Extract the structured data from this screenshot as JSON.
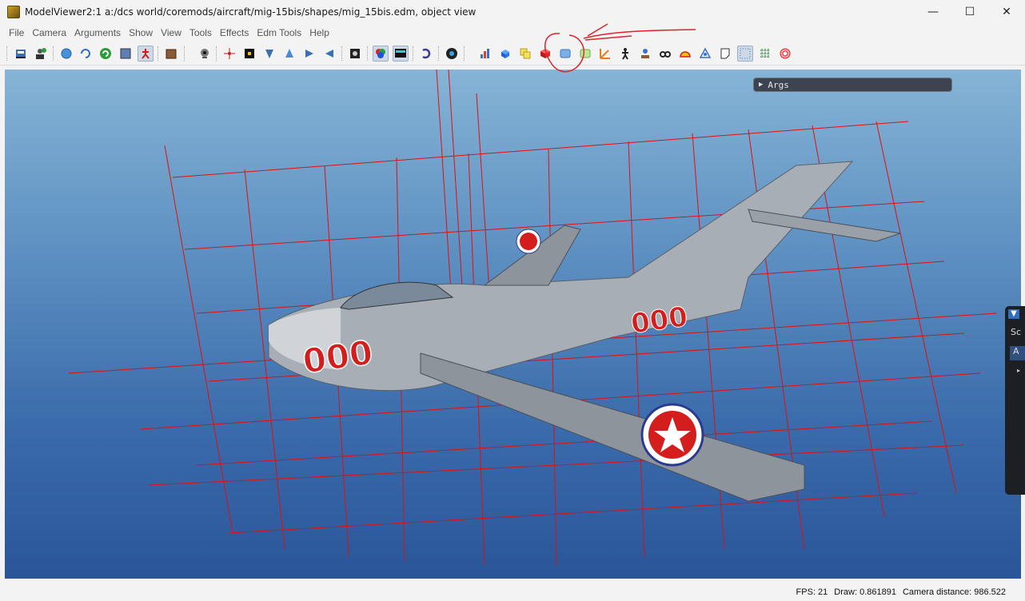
{
  "window": {
    "title": "ModelViewer2:1 a:/dcs world/coremods/aircraft/mig-15bis/shapes/mig_15bis.edm, object view",
    "minimize": "—",
    "maximize": "☐",
    "close": "✕"
  },
  "menu": {
    "items": [
      "File",
      "Camera",
      "Arguments",
      "Show",
      "View",
      "Tools",
      "Effects",
      "Edm Tools",
      "Help"
    ]
  },
  "toolbar": {
    "icons": [
      "open-file-icon",
      "add-user-icon",
      "globe-icon",
      "refresh-icon",
      "reload-green-icon",
      "picture-icon",
      "skeleton-icon",
      "cube-brown-icon",
      "webcam-icon",
      "crosshair-icon",
      "black-square-icon",
      "light-cone-icon",
      "light-spot-icon",
      "arrow-right-icon",
      "arrow-left-icon",
      "material-icon",
      "color-rgb-icon",
      "monitor-icon",
      "undo-arc-icon",
      "eye-ball-icon",
      "bar-chart-icon",
      "blue-cube-icon",
      "yellow-boxes-icon",
      "red-cube-icon",
      "blue-box-icon",
      "green-box-icon",
      "axes-icon",
      "figure-icon",
      "lamp-icon",
      "goggles-icon",
      "shell-icon",
      "network-icon",
      "note-icon",
      "grid-dots-icon",
      "green-grid-icon",
      "target-icon"
    ]
  },
  "viewport": {
    "args_label": "Args",
    "side_panel": {
      "text1": "Sc",
      "text2": "A",
      "text3": "▸"
    },
    "aircraft_number": "000"
  },
  "status": {
    "fps": "FPS: 21",
    "draw": "Draw: 0.861891",
    "camera": "Camera distance: 986.522"
  },
  "colors": {
    "sky_top": "#86b4d6",
    "sky_bottom": "#2a5699",
    "grid": "#e01010",
    "annotation": "#e0202a",
    "roundel_red": "#d41e1e"
  }
}
